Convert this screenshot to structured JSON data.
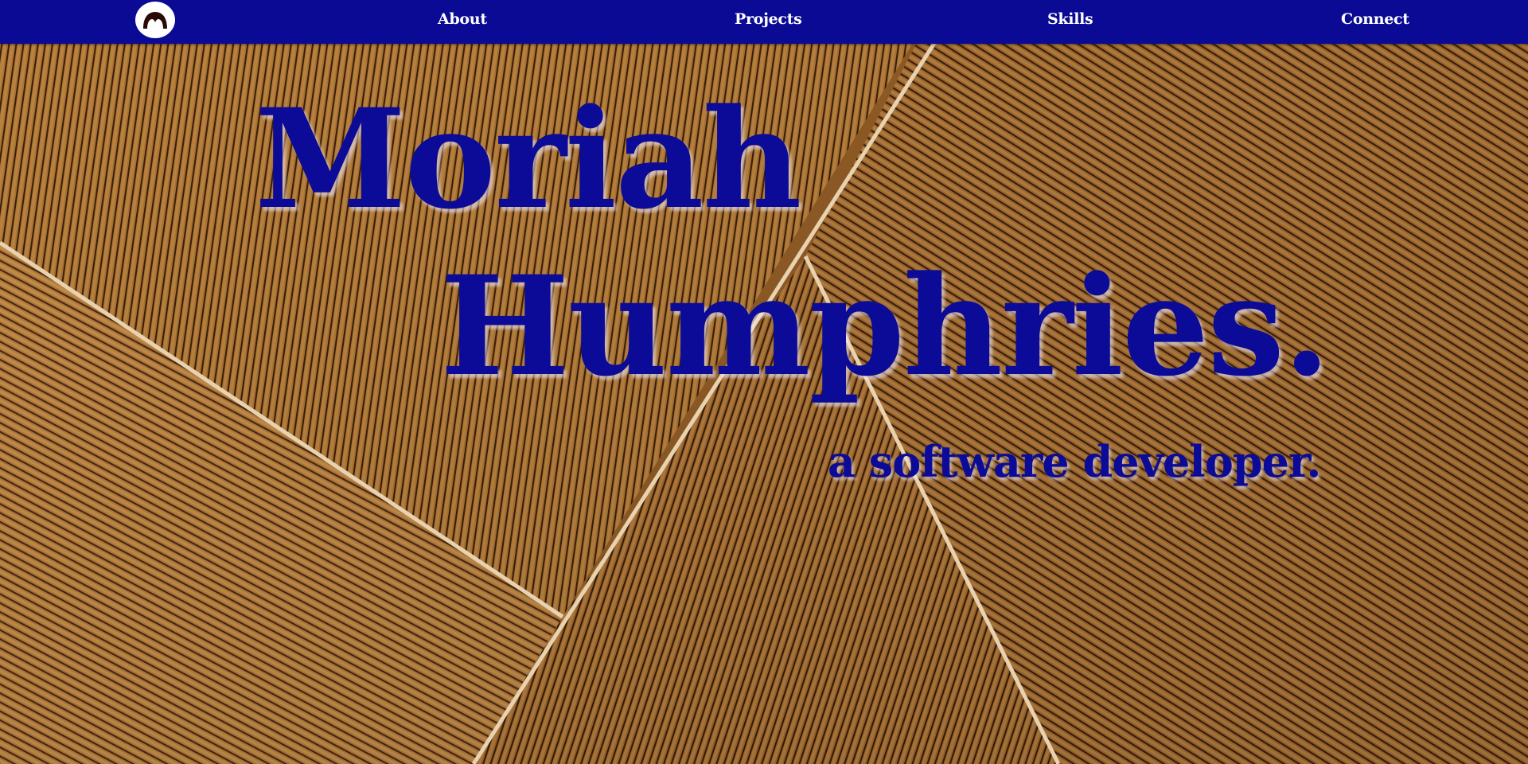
{
  "nav": {
    "logo_icon": "mustache-icon",
    "links": [
      {
        "label": "About"
      },
      {
        "label": "Projects"
      },
      {
        "label": "Skills"
      },
      {
        "label": "Connect"
      }
    ]
  },
  "hero": {
    "first_name": "Moriah",
    "last_name": "Humphries.",
    "tagline": "a software developer."
  },
  "colors": {
    "nav_background": "#0a0a95",
    "hero_text": "#0b0b97",
    "nav_text": "#ffffff",
    "wood": "#9a6228"
  }
}
